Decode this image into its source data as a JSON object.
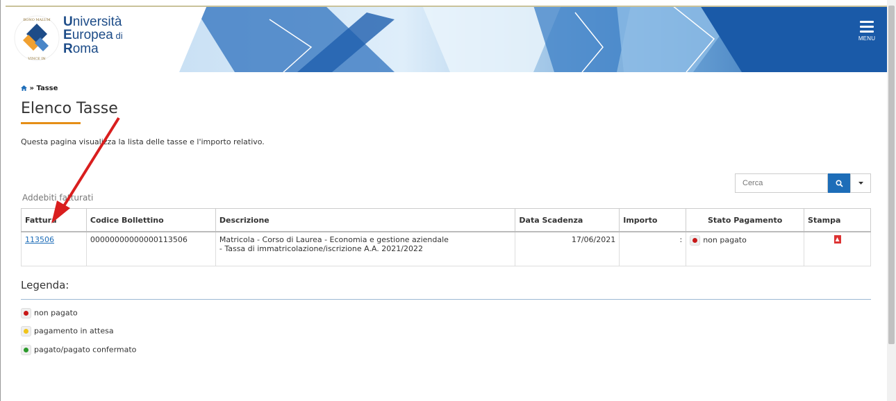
{
  "header": {
    "logo": {
      "line1_cap": "U",
      "line1_rest": "niversità",
      "line2_cap": "E",
      "line2_rest": "uropea",
      "line2_small": " di",
      "line3_cap": "R",
      "line3_rest": "oma",
      "seal_text": "VINCE IN BONO MALUM"
    },
    "menu_label": "MENU"
  },
  "breadcrumb": {
    "home_icon": "home-icon",
    "separator": "»",
    "current": "Tasse"
  },
  "page": {
    "title": "Elenco Tasse",
    "intro": "Questa pagina visualizza la lista delle tasse e l'importo relativo.",
    "section_title": "Addebiti fatturati"
  },
  "search": {
    "placeholder": "Cerca"
  },
  "table": {
    "headers": [
      "Fattura",
      "Codice Bollettino",
      "Descrizione",
      "Data Scadenza",
      "Importo",
      "Stato Pagamento",
      "Stampa"
    ],
    "rows": [
      {
        "fattura": "113506",
        "codice": "00000000000000113506",
        "descrizione_1": "Matricola - Corso di Laurea - Economia e gestione aziendale",
        "descrizione_2": "- Tassa di immatricolazione/iscrizione A.A. 2021/2022",
        "data_scadenza": "17/06/2021",
        "importo": ":",
        "stato": "non pagato",
        "stato_color": "#c81818"
      }
    ]
  },
  "legend": {
    "title": "Legenda:",
    "items": [
      {
        "label": "non pagato",
        "color": "#c81818"
      },
      {
        "label": "pagamento in attesa",
        "color": "#f0c419"
      },
      {
        "label": "pagato/pagato confermato",
        "color": "#2b9a2b"
      }
    ]
  },
  "colors": {
    "brand_blue": "#1a5aa8",
    "accent_orange": "#e58e16",
    "annotation_arrow": "#d91e1e"
  }
}
